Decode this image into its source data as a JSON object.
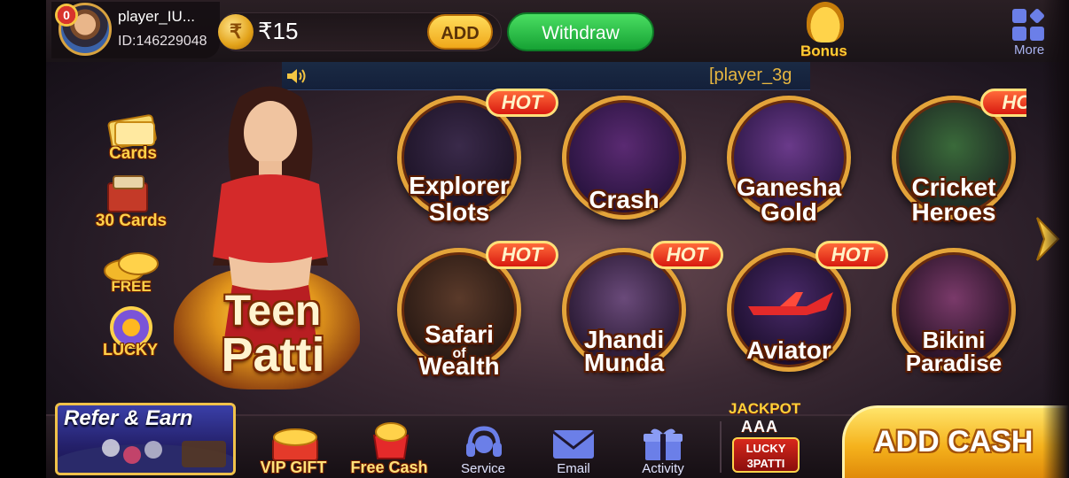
{
  "header": {
    "vip_level": "0",
    "player_name": "player_IU...",
    "player_id": "ID:146229048",
    "currency_symbol": "₹",
    "balance": "₹15",
    "add_label": "ADD",
    "withdraw_label": "Withdraw",
    "bonus_label": "Bonus",
    "more_label": "More"
  },
  "marquee": {
    "text": "[player_3g"
  },
  "side_menu": [
    {
      "label": "Cards",
      "icon": "cards-icon"
    },
    {
      "label": "30 Cards",
      "icon": "30-cards-icon"
    },
    {
      "label": "FREE",
      "icon": "free-coins-icon"
    },
    {
      "label": "LUCKY",
      "icon": "lucky-wheel-icon"
    }
  ],
  "hero": {
    "title_line1": "Teen",
    "title_line2": "Patti"
  },
  "games": [
    {
      "line1": "Explorer",
      "line2": "Slots",
      "hot": "HOT"
    },
    {
      "line1": "Crash",
      "line2": "",
      "hot": ""
    },
    {
      "line1": "Ganesha",
      "line2": "Gold",
      "hot": ""
    },
    {
      "line1": "Cricket",
      "line2": "Heroes",
      "hot": "HO"
    },
    {
      "line1": "Safari",
      "line_of": "of",
      "line2": "Wealth",
      "hot": "HOT"
    },
    {
      "line1": "Jhandi",
      "line2": "Munda",
      "hot": "HOT"
    },
    {
      "line1": "Aviator",
      "line2": "",
      "hot": "HOT"
    },
    {
      "line1": "Bikini",
      "line2": "Paradise",
      "hot": ""
    }
  ],
  "bottom_nav": {
    "refer_label": "Refer & Earn",
    "vip_gift": "VIP GIFT",
    "free_cash": "Free Cash",
    "service": "Service",
    "email": "Email",
    "activity": "Activity",
    "jackpot_top": "JACKPOT",
    "jackpot_cards": "AAA",
    "jackpot_line1": "LUCKY",
    "jackpot_line2": "3PATTI",
    "add_cash": "ADD CASH"
  },
  "colors": {
    "gold": "#ffd24a",
    "withdraw_green": "#16a234",
    "hot_red": "#d81a10",
    "nav_blue": "#6b7fe8"
  }
}
